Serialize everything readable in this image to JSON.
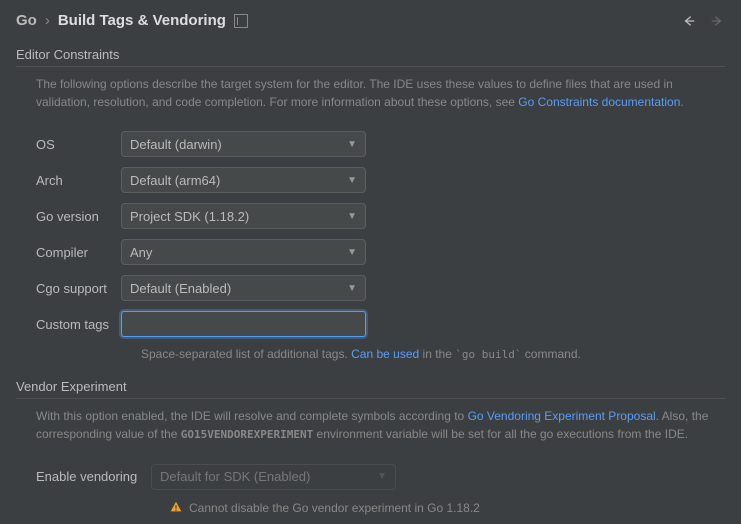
{
  "breadcrumb": {
    "root": "Go",
    "current": "Build Tags & Vendoring"
  },
  "editor_constraints": {
    "title": "Editor Constraints",
    "desc_prefix": "The following options describe the target system for the editor. The IDE uses these values to define files that are used in validation, resolution, and code completion. For more information about these options, see ",
    "desc_link": "Go Constraints documentation",
    "desc_suffix": ".",
    "fields": {
      "os": {
        "label": "OS",
        "value": "Default (darwin)"
      },
      "arch": {
        "label": "Arch",
        "value": "Default (arm64)"
      },
      "go_version": {
        "label": "Go version",
        "value": "Project SDK (1.18.2)"
      },
      "compiler": {
        "label": "Compiler",
        "value": "Any"
      },
      "cgo_support": {
        "label": "Cgo support",
        "value": "Default (Enabled)"
      },
      "custom_tags": {
        "label": "Custom tags",
        "value": ""
      }
    },
    "custom_tags_helper": {
      "prefix": "Space-separated list of additional tags. ",
      "link": "Can be used",
      "mid": " in the ",
      "code": "`go build`",
      "suffix": " command."
    }
  },
  "vendor_experiment": {
    "title": "Vendor Experiment",
    "desc_prefix": "With this option enabled, the IDE will resolve and complete symbols according to ",
    "desc_link": "Go Vendoring Experiment Proposal",
    "desc_mid": ". Also, the corresponding value of the ",
    "desc_code": "GO15VENDOREXPERIMENT",
    "desc_suffix": " environment variable will be set for all the go executions from the IDE.",
    "enable_label": "Enable vendoring",
    "enable_value": "Default for SDK (Enabled)",
    "warning": "Cannot disable the Go vendor experiment in Go 1.18.2"
  }
}
